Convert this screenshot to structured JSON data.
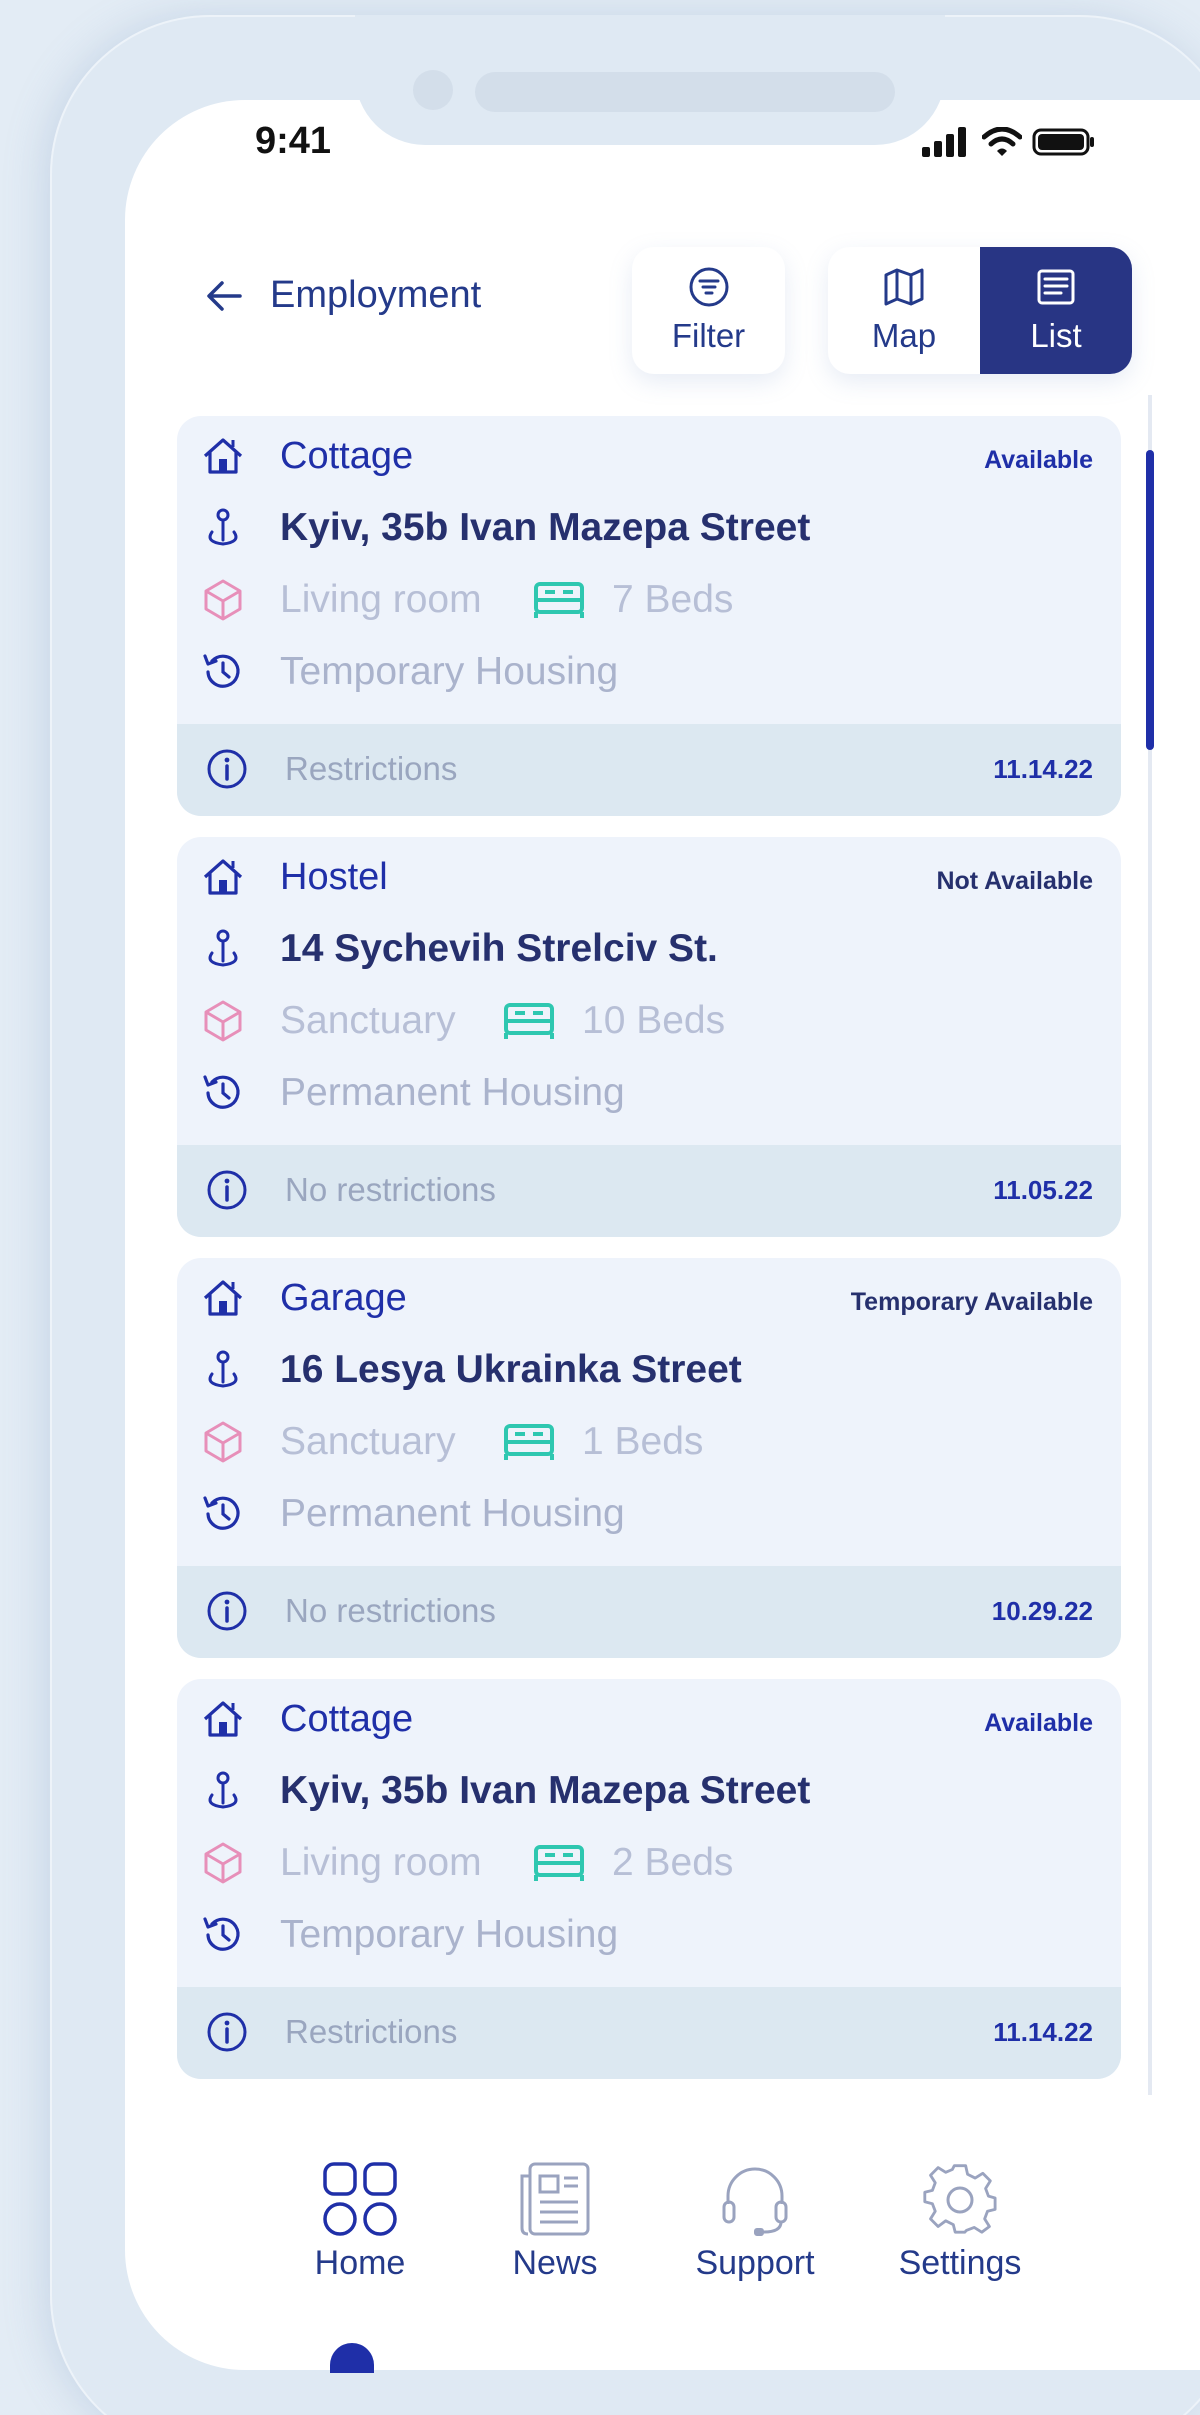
{
  "status_bar": {
    "time": "9:41"
  },
  "header": {
    "title": "Employment",
    "filter_label": "Filter",
    "map_label": "Map",
    "list_label": "List"
  },
  "listings": [
    {
      "type": "Cottage",
      "status": "Available",
      "address": "Kyiv, 35b Ivan Mazepa Street",
      "room": "Living room",
      "beds": "7 Beds",
      "housing": "Temporary Housing",
      "restrictions": "Restrictions",
      "date": "11.14.22"
    },
    {
      "type": "Hostel",
      "status": "Not Available",
      "address": "14 Sychevih Strelciv St.",
      "room": "Sanctuary",
      "beds": "10 Beds",
      "housing": "Permanent Housing",
      "restrictions": "No restrictions",
      "date": "11.05.22"
    },
    {
      "type": "Garage",
      "status": "Temporary Available",
      "address": "16 Lesya Ukrainka Street",
      "room": "Sanctuary",
      "beds": "1 Beds",
      "housing": "Permanent Housing",
      "restrictions": "No restrictions",
      "date": "10.29.22"
    },
    {
      "type": "Cottage",
      "status": "Available",
      "address": "Kyiv, 35b Ivan Mazepa Street",
      "room": "Living room",
      "beds": "2 Beds",
      "housing": "Temporary Housing",
      "restrictions": "Restrictions",
      "date": "11.14.22"
    }
  ],
  "tabbar": {
    "home": "Home",
    "news": "News",
    "support": "Support",
    "settings": "Settings",
    "active": "home"
  },
  "colors": {
    "accent": "#1f2fa8",
    "navy": "#283584",
    "card_bg": "#eef3fb",
    "footer_bg": "#dce8f1",
    "bed_icon": "#2ec7b0",
    "room_icon": "#e78fb9"
  }
}
